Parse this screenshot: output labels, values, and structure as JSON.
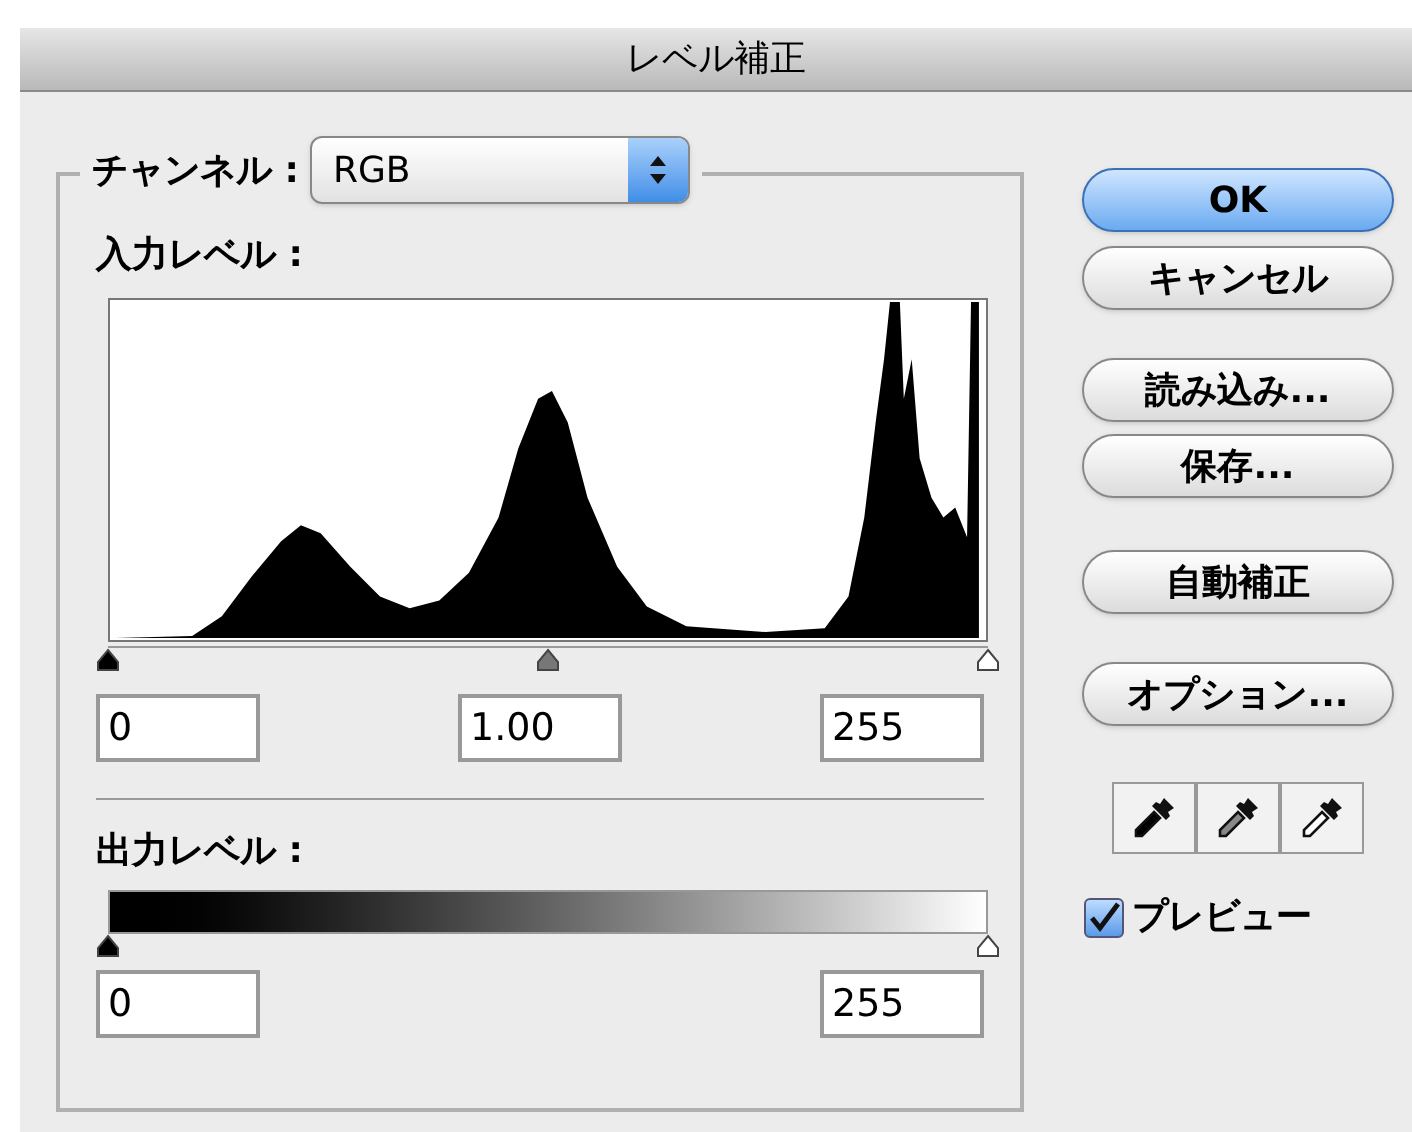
{
  "window": {
    "title": "レベル補正"
  },
  "channel": {
    "label": "チャンネル :",
    "value": "RGB"
  },
  "input_levels": {
    "label": "入力レベル :",
    "handles": [
      {
        "kind": "black",
        "level": 0
      },
      {
        "kind": "gray",
        "level": 0.5
      },
      {
        "kind": "white",
        "level": 1
      }
    ],
    "fields": [
      {
        "value": "0"
      },
      {
        "value": "1.00"
      },
      {
        "value": "255"
      }
    ]
  },
  "output_levels": {
    "label": "出力レベル :",
    "handles": [
      {
        "kind": "black",
        "level": 0
      },
      {
        "kind": "white",
        "level": 1
      }
    ],
    "fields": [
      {
        "value": "0"
      },
      {
        "value": "255"
      }
    ]
  },
  "buttons": [
    {
      "label": "OK",
      "default": true
    },
    {
      "label": "キャンセル",
      "default": false
    },
    {
      "label": "読み込み...",
      "default": false
    },
    {
      "label": "保存...",
      "default": false
    },
    {
      "label": "自動補正",
      "default": false
    },
    {
      "label": "オプション...",
      "default": false
    }
  ],
  "preview": {
    "label": "プレビュー",
    "checked": true
  }
}
